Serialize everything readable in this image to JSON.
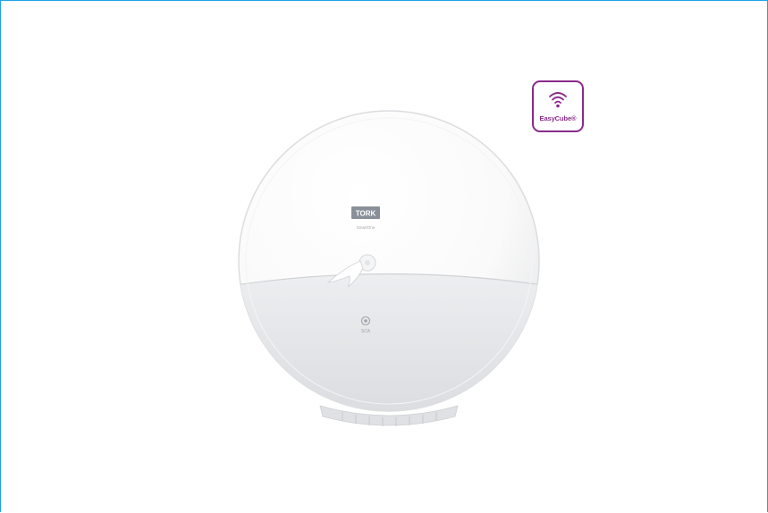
{
  "product": {
    "name": "Tork SmartOne mini toilet roll dispenser",
    "brand_label": "TORK",
    "model_label": "SmartOne",
    "maker_label": "SCA"
  },
  "badge": {
    "label": "EasyCube®",
    "icon": "wifi-icon",
    "color": "#8a2a8c"
  },
  "frame": {
    "border_color": "#1da1e8"
  }
}
